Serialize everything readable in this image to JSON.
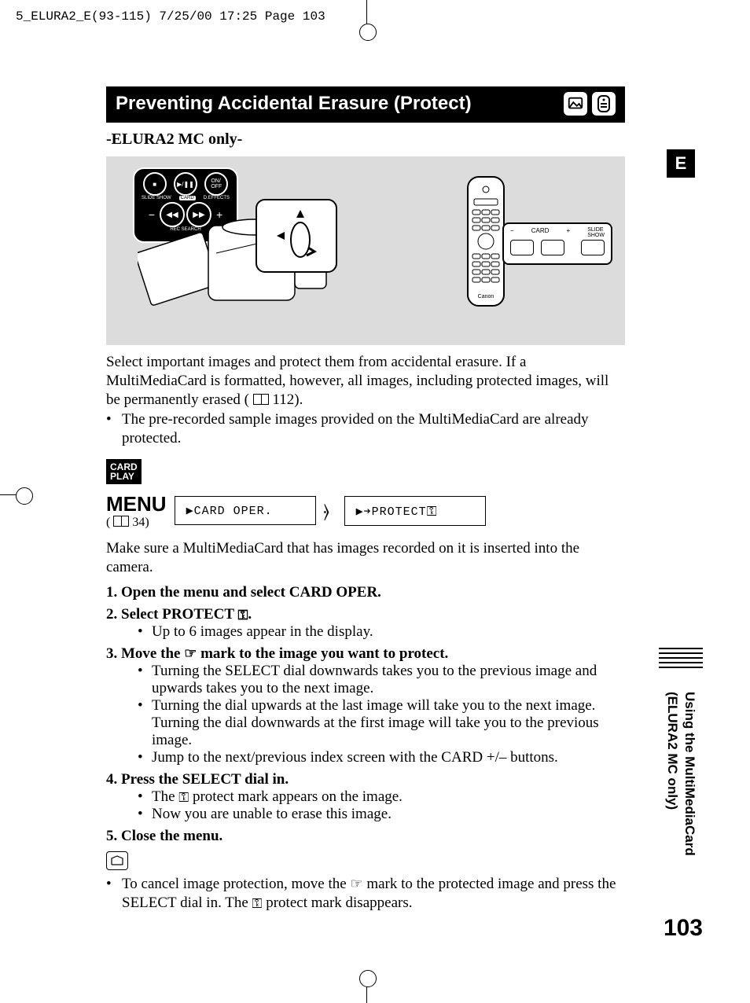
{
  "print_header": "5_ELURA2_E(93-115)   7/25/00 17:25  Page 103",
  "title": "Preventing Accidental Erasure (Protect)",
  "subtitle": "-ELURA2 MC only-",
  "side_tab": "E",
  "side_section_line1": "Using the MultiMediaCard",
  "side_section_line2": "(ELURA2 MC only)",
  "page_number": "103",
  "illus": {
    "controls": {
      "stop": "■",
      "play": "▶/❚❚",
      "onoff": "ON/\nOFF",
      "label_left": "SLIDE SHOW",
      "label_mid": "CARD",
      "label_right": "D.EFFECTS",
      "minus": "−",
      "rew": "◀◀",
      "ff": "▶▶",
      "plus": "+",
      "rec_search": "REC SEARCH"
    },
    "remote_callout": {
      "minus": "−",
      "card": "CARD",
      "plus": "+",
      "slide": "SLIDE\nSHOW"
    }
  },
  "intro_p1a": "Select important images and protect them from accidental erasure. If a MultiMediaCard is formatted, however, all images, including protected images, will be permanently erased ( ",
  "intro_ref": "112).",
  "intro_bullet": "The pre-recorded sample images provided on the MultiMediaCard are already protected.",
  "mode_badge": "CARD\nPLAY",
  "menu_label": "MENU",
  "menu_ref": "34)",
  "menu_box1": "▶CARD OPER.",
  "menu_box2": "▶➔PROTECT",
  "lead": "Make sure a MultiMediaCard that has images recorded on it is inserted into the camera.",
  "steps": {
    "s1": "1.  Open the menu and select CARD OPER.",
    "s2": "2.  Select PROTECT ",
    "s2_end": ".",
    "s2b1": "Up to 6 images appear in the display.",
    "s3_a": "3.  Move the ",
    "s3_b": " mark to the image you want to protect.",
    "s3b1": "Turning the SELECT dial downwards takes you to the previous image and upwards takes you to the next image.",
    "s3b2": "Turning the dial upwards at the last image will take you to the next image. Turning the dial downwards at the first image will take you to the previous image.",
    "s3b3": "Jump to the next/previous index screen with the CARD +/– buttons.",
    "s4": "4.  Press the SELECT dial in.",
    "s4b1a": "The ",
    "s4b1b": " protect mark appears on the image.",
    "s4b2": "Now you are unable to erase this image.",
    "s5": "5.  Close the menu."
  },
  "note_a": "To cancel image protection, move the ",
  "note_b": " mark to the protected image and press the SELECT dial in. The ",
  "note_c": " protect mark disappears."
}
